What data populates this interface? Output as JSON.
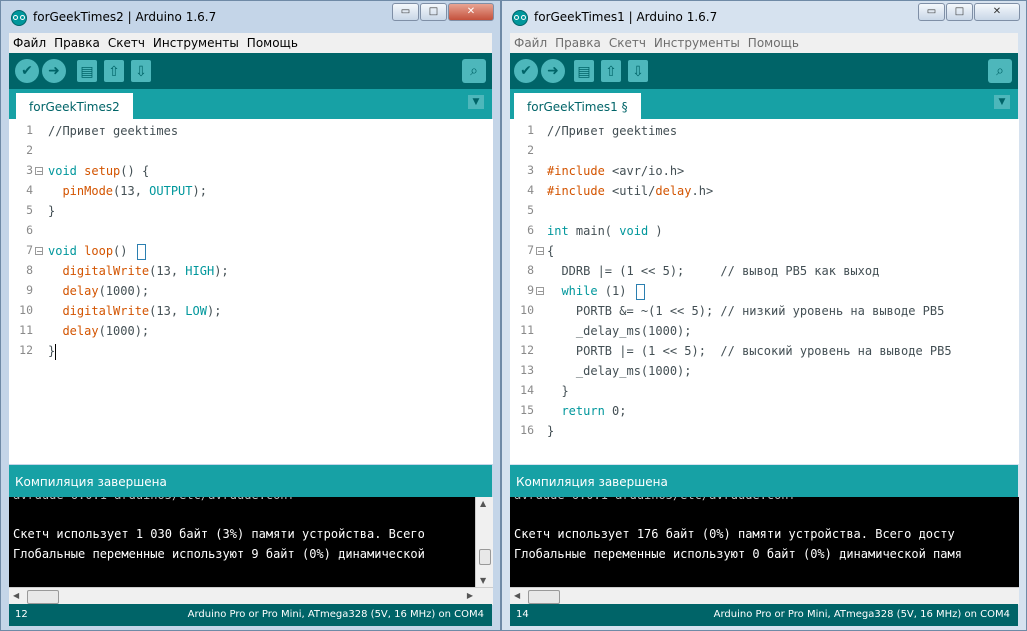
{
  "menu": [
    "Файл",
    "Правка",
    "Скетч",
    "Инструменты",
    "Помощь"
  ],
  "window_controls": {
    "minimize": "▭",
    "maximize": "□",
    "close": "✕"
  },
  "left": {
    "title": "forGeekTimes2 | Arduino 1.6.7",
    "tab": "forGeekTimes2",
    "status": "Компиляция завершена",
    "console": [
      "Скетч использует 1 030 байт (3%) памяти устройства. Всего",
      "Глобальные переменные используют 9 байт (0%) динамической"
    ],
    "line": "12",
    "board": "Arduino Pro or Pro Mini, ATmega328 (5V, 16 MHz) on COM4",
    "line_numbers": [
      "1",
      "2",
      "3",
      "4",
      "5",
      "6",
      "7",
      "8",
      "9",
      "10",
      "11",
      "12"
    ]
  },
  "right": {
    "title": "forGeekTimes1 | Arduino 1.6.7",
    "tab": "forGeekTimes1 §",
    "status": "Компиляция завершена",
    "console": [
      "Скетч использует 176 байт (0%) памяти устройства. Всего досту",
      "Глобальные переменные используют 0 байт (0%) динамической памя"
    ],
    "line": "14",
    "board": "Arduino Pro or Pro Mini, ATmega328 (5V, 16 MHz) on COM4",
    "line_numbers": [
      "1",
      "2",
      "3",
      "4",
      "5",
      "6",
      "7",
      "8",
      "9",
      "10",
      "11",
      "12",
      "13",
      "14",
      "15",
      "16"
    ]
  },
  "code_left": [
    [
      {
        "t": "//Привет geektimes",
        "c": "cm"
      }
    ],
    [],
    [
      {
        "t": "void",
        "c": "kw"
      },
      {
        "t": " "
      },
      {
        "t": "setup",
        "c": "fn"
      },
      {
        "t": "() {"
      }
    ],
    [
      {
        "t": "  "
      },
      {
        "t": "pinMode",
        "c": "fn"
      },
      {
        "t": "(13, "
      },
      {
        "t": "OUTPUT",
        "c": "kw"
      },
      {
        "t": ");"
      }
    ],
    [
      {
        "t": "}"
      }
    ],
    [],
    [
      {
        "t": "void",
        "c": "kw"
      },
      {
        "t": " "
      },
      {
        "t": "loop",
        "c": "fn"
      },
      {
        "t": "() "
      }
    ],
    [
      {
        "t": "  "
      },
      {
        "t": "digitalWrite",
        "c": "fn"
      },
      {
        "t": "(13, "
      },
      {
        "t": "HIGH",
        "c": "kw"
      },
      {
        "t": ");"
      }
    ],
    [
      {
        "t": "  "
      },
      {
        "t": "delay",
        "c": "fn"
      },
      {
        "t": "(1000);"
      }
    ],
    [
      {
        "t": "  "
      },
      {
        "t": "digitalWrite",
        "c": "fn"
      },
      {
        "t": "(13, "
      },
      {
        "t": "LOW",
        "c": "kw"
      },
      {
        "t": ");"
      }
    ],
    [
      {
        "t": "  "
      },
      {
        "t": "delay",
        "c": "fn"
      },
      {
        "t": "(1000);"
      }
    ],
    [
      {
        "t": "}"
      }
    ]
  ],
  "code_right": [
    [
      {
        "t": "//Привет geektimes",
        "c": "cm"
      }
    ],
    [],
    [
      {
        "t": "#include",
        "c": "fn"
      },
      {
        "t": " <avr/io.h>"
      }
    ],
    [
      {
        "t": "#include",
        "c": "fn"
      },
      {
        "t": " <util/"
      },
      {
        "t": "delay",
        "c": "fn"
      },
      {
        "t": ".h>"
      }
    ],
    [],
    [
      {
        "t": "int",
        "c": "kw"
      },
      {
        "t": " main( "
      },
      {
        "t": "void",
        "c": "kw"
      },
      {
        "t": " )"
      }
    ],
    [
      {
        "t": "{"
      }
    ],
    [
      {
        "t": "  DDRB |= (1 << 5);     // вывод PB5 как выход"
      }
    ],
    [
      {
        "t": "  "
      },
      {
        "t": "while",
        "c": "kw"
      },
      {
        "t": " (1) "
      }
    ],
    [
      {
        "t": "    PORTB &= ~(1 << 5); // низкий уровень на выводе PB5"
      }
    ],
    [
      {
        "t": "    _delay_ms(1000);"
      }
    ],
    [
      {
        "t": "    PORTB |= (1 << 5);  // высокий уровень на выводе PB5"
      }
    ],
    [
      {
        "t": "    _delay_ms(1000);"
      }
    ],
    [
      {
        "t": "  }"
      }
    ],
    [
      {
        "t": "  "
      },
      {
        "t": "return",
        "c": "kw"
      },
      {
        "t": " 0;"
      }
    ],
    [
      {
        "t": "}"
      }
    ]
  ]
}
